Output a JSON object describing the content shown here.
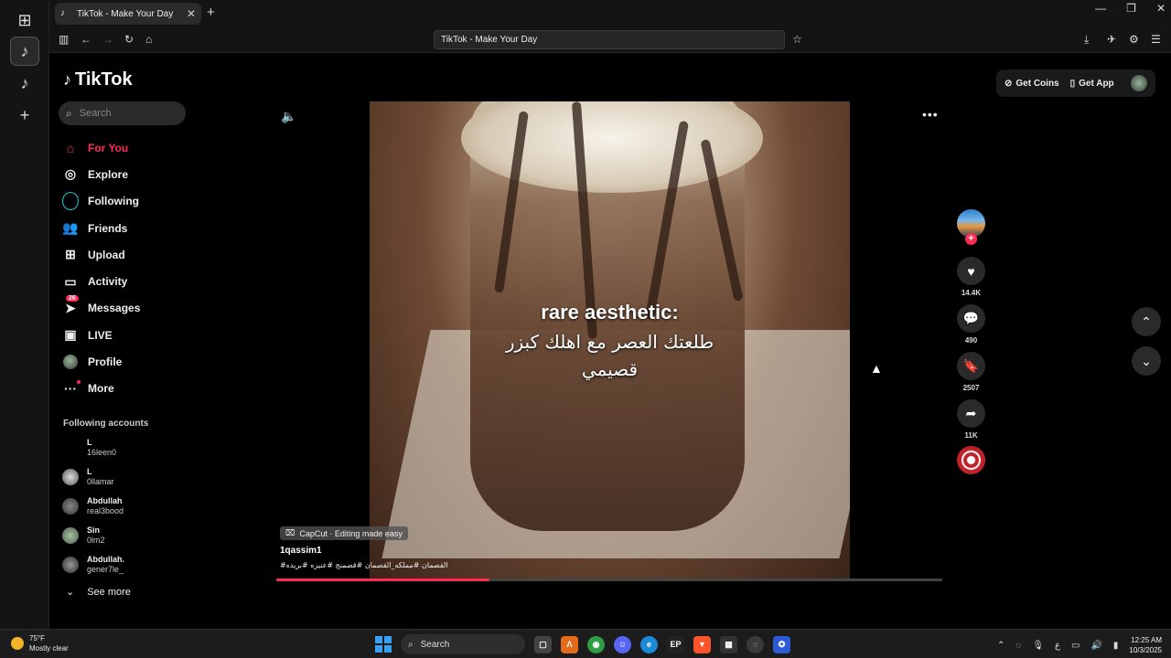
{
  "browser": {
    "tab_title": "TikTok - Make Your Day",
    "address": "TikTok - Make Your Day"
  },
  "tiktok": {
    "logo": "TikTok",
    "search_placeholder": "Search",
    "nav": [
      {
        "label": "For You"
      },
      {
        "label": "Explore"
      },
      {
        "label": "Following"
      },
      {
        "label": "Friends"
      },
      {
        "label": "Upload"
      },
      {
        "label": "Activity"
      },
      {
        "label": "Messages",
        "badge": "26"
      },
      {
        "label": "LIVE"
      },
      {
        "label": "Profile"
      },
      {
        "label": "More"
      }
    ],
    "following_title": "Following accounts",
    "accounts": [
      {
        "name": "L",
        "handle": "16leen0"
      },
      {
        "name": "L",
        "handle": "0llamar"
      },
      {
        "name": "Abdullah",
        "handle": "real3bood"
      },
      {
        "name": "Sin",
        "handle": "0lm2"
      },
      {
        "name": "Abdullah.",
        "handle": "gener7le_"
      }
    ],
    "see_more": "See more",
    "get_coins": "Get Coins",
    "get_app": "Get App"
  },
  "video": {
    "caption_en": "rare aesthetic:",
    "caption_ar_line1": "طلعتك العصر مع اهلك كبزر",
    "caption_ar_line2": "قصيمي",
    "capcut_label": "CapCut · Editing made easy",
    "username": "1qassim1",
    "hashtags": "#القصمان #مملكه_القصمان #قصمنج #عنيزه #بريده",
    "progress": 0.32,
    "likes": "14.4K",
    "comments": "490",
    "saves": "2507",
    "shares": "11K"
  },
  "taskbar": {
    "temp": "75°F",
    "condition": "Mostly clear",
    "search": "Search",
    "lang": "ع",
    "time": "12:25 AM",
    "date": "10/3/2025"
  },
  "colors": {
    "accent": "#fe2c55",
    "following_ring": "#1ecbe1"
  }
}
